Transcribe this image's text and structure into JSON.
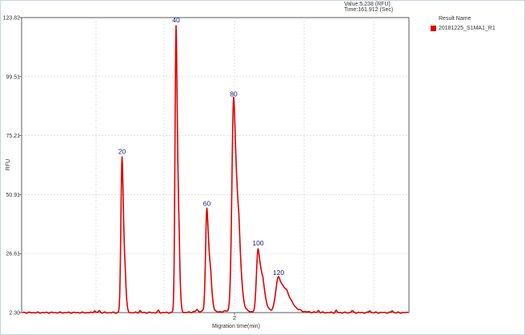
{
  "hover_readout": {
    "value_line": "Value:5.238 (RFU)",
    "time_line": "Time:161.912 (Sec)"
  },
  "legend": {
    "title": "Result Name",
    "entries": [
      {
        "label": "20181225_S1MA1_R1",
        "color": "#e00000"
      }
    ]
  },
  "chart_data": {
    "type": "line",
    "title": "",
    "xlabel": "Migration time(min)",
    "ylabel": "RFU",
    "x_ticks": [
      "2"
    ],
    "y_ticks": [
      "123.82",
      "99.51",
      "75.21",
      "50.91",
      "26.61",
      "2.30"
    ],
    "ylim": [
      2.3,
      123.82
    ],
    "grid": true,
    "legend_position": "right",
    "series": [
      {
        "name": "20181225_S1MA1_R1",
        "color": "#e00000",
        "baseline": 2.3,
        "peaks": [
          {
            "label": "20",
            "value": 66.4
          },
          {
            "label": "40",
            "value": 120.5
          },
          {
            "label": "60",
            "value": 45.0
          },
          {
            "label": "80",
            "value": 90.0
          },
          {
            "label": "100",
            "value": 28.6
          },
          {
            "label": "120",
            "value": 16.4
          }
        ]
      }
    ]
  }
}
